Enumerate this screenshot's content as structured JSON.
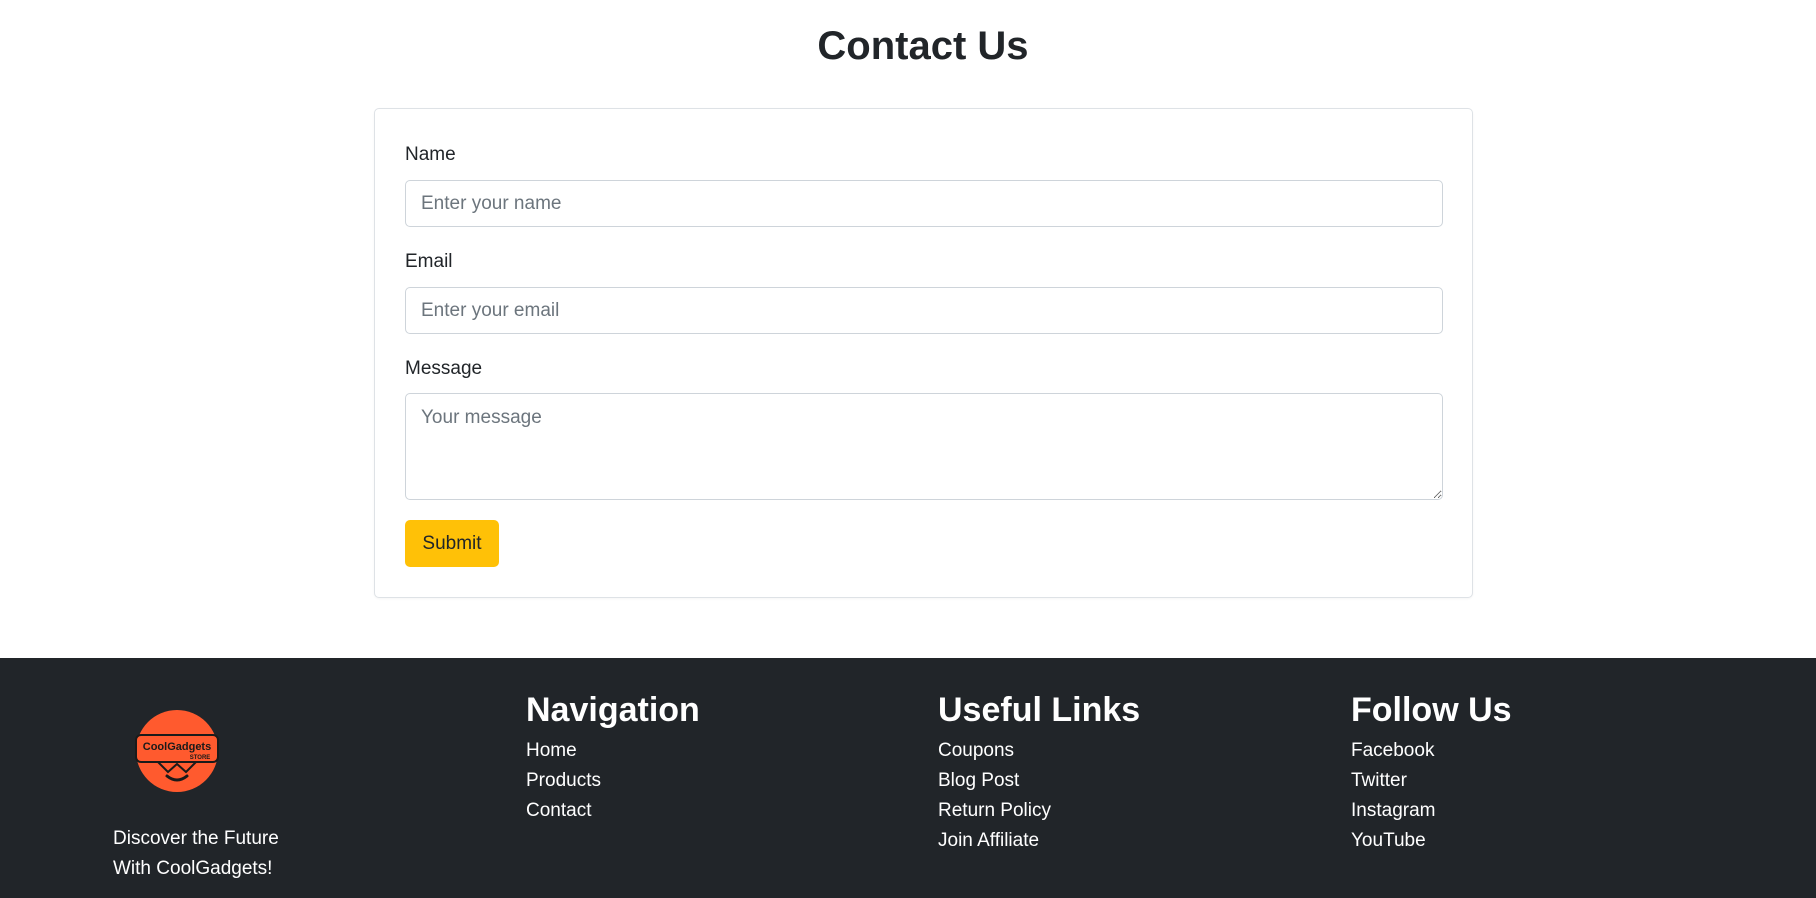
{
  "page": {
    "title": "Contact Us"
  },
  "form": {
    "name_label": "Name",
    "name_placeholder": "Enter your name",
    "email_label": "Email",
    "email_placeholder": "Enter your email",
    "message_label": "Message",
    "message_placeholder": "Your message",
    "submit_label": "Submit"
  },
  "footer": {
    "logo": {
      "text": "CoolGadgets",
      "subtext": "STORE",
      "color": "#ff5a2e"
    },
    "tagline": [
      "Discover the Future",
      "With CoolGadgets!"
    ],
    "columns": [
      {
        "heading": "Navigation",
        "links": [
          "Home",
          "Products",
          "Contact"
        ]
      },
      {
        "heading": "Useful Links",
        "links": [
          "Coupons",
          "Blog Post",
          "Return Policy",
          "Join Affiliate"
        ]
      },
      {
        "heading": "Follow Us",
        "links": [
          "Facebook",
          "Twitter",
          "Instagram",
          "YouTube"
        ]
      }
    ]
  },
  "colors": {
    "accent": "#ffc107",
    "footer_bg": "#212529",
    "text": "#212529",
    "border": "#ced4da"
  }
}
